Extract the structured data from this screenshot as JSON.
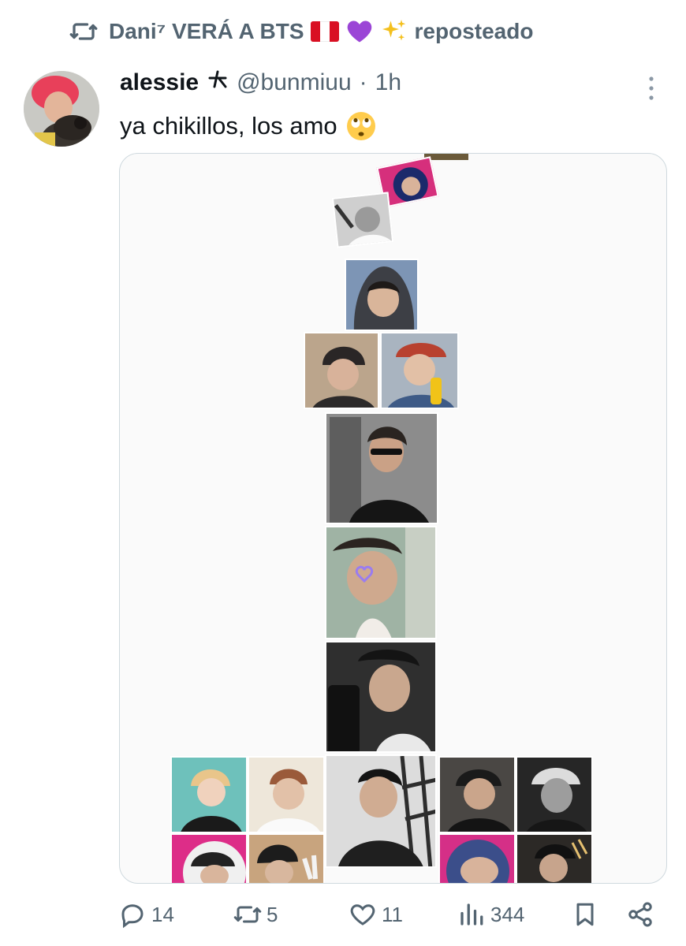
{
  "repost": {
    "icon": "repost-icon",
    "user": "Dani⁷ VERÁ A BTS",
    "suffix": "reposteado"
  },
  "author": {
    "name": "alessie",
    "handle": "@bunmiuu",
    "separator": "·",
    "time": "1h"
  },
  "tweet": {
    "text": "ya chikillos, los amo"
  },
  "actions": {
    "replies": "14",
    "reposts": "5",
    "likes": "11",
    "views": "344"
  },
  "colors": {
    "secondary_text": "#536471",
    "border": "#cfd9de"
  }
}
